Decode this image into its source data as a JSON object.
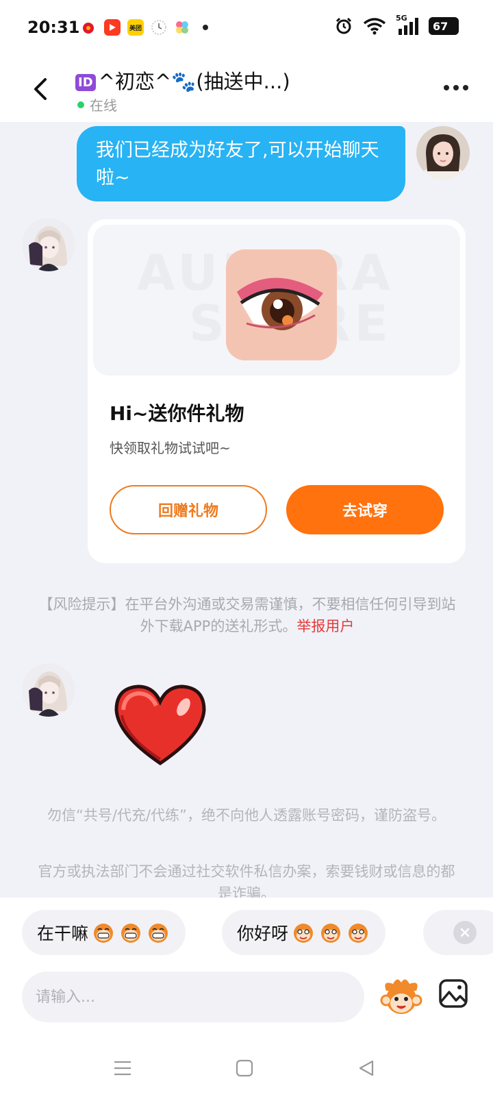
{
  "status_bar": {
    "time": "20:31",
    "app_icons": [
      "weibo-icon",
      "video-app-icon",
      "meituan-icon",
      "clock-app-icon",
      "gallery-app-icon"
    ],
    "meituan_label": "美团",
    "network": "5G",
    "battery": "67"
  },
  "header": {
    "id_badge": "ID",
    "title": "^初恋^🐾(抽送中...)",
    "status": "在线"
  },
  "messages": {
    "friend_notice": "我们已经成为好友了,可以开始聊天啦~",
    "gift_card": {
      "watermark_1": "AURORA",
      "watermark_2": "STORE",
      "title": "Hi~送你件礼物",
      "subtitle": "快领取礼物试试吧~",
      "return_gift_label": "回赠礼物",
      "try_on_label": "去试穿"
    },
    "risk_tip": "【风险提示】在平台外沟通或交易需谨慎，不要相信任何引导到站外下载APP的送礼形式。",
    "report_label": "举报用户",
    "notice_1": "勿信“共号/代充/代练”，绝不向他人透露账号密码，谨防盗号。",
    "notice_2": "官方或执法部门不会通过社交软件私信办案，索要钱财或信息的都是诈骗。"
  },
  "quick_replies": [
    "在干嘛",
    "你好呀"
  ],
  "input": {
    "placeholder": "请输入..."
  },
  "colors": {
    "accent": "#ff720e",
    "bubble": "#27b3f4",
    "danger": "#e33b3b",
    "online": "#2ed06e"
  }
}
